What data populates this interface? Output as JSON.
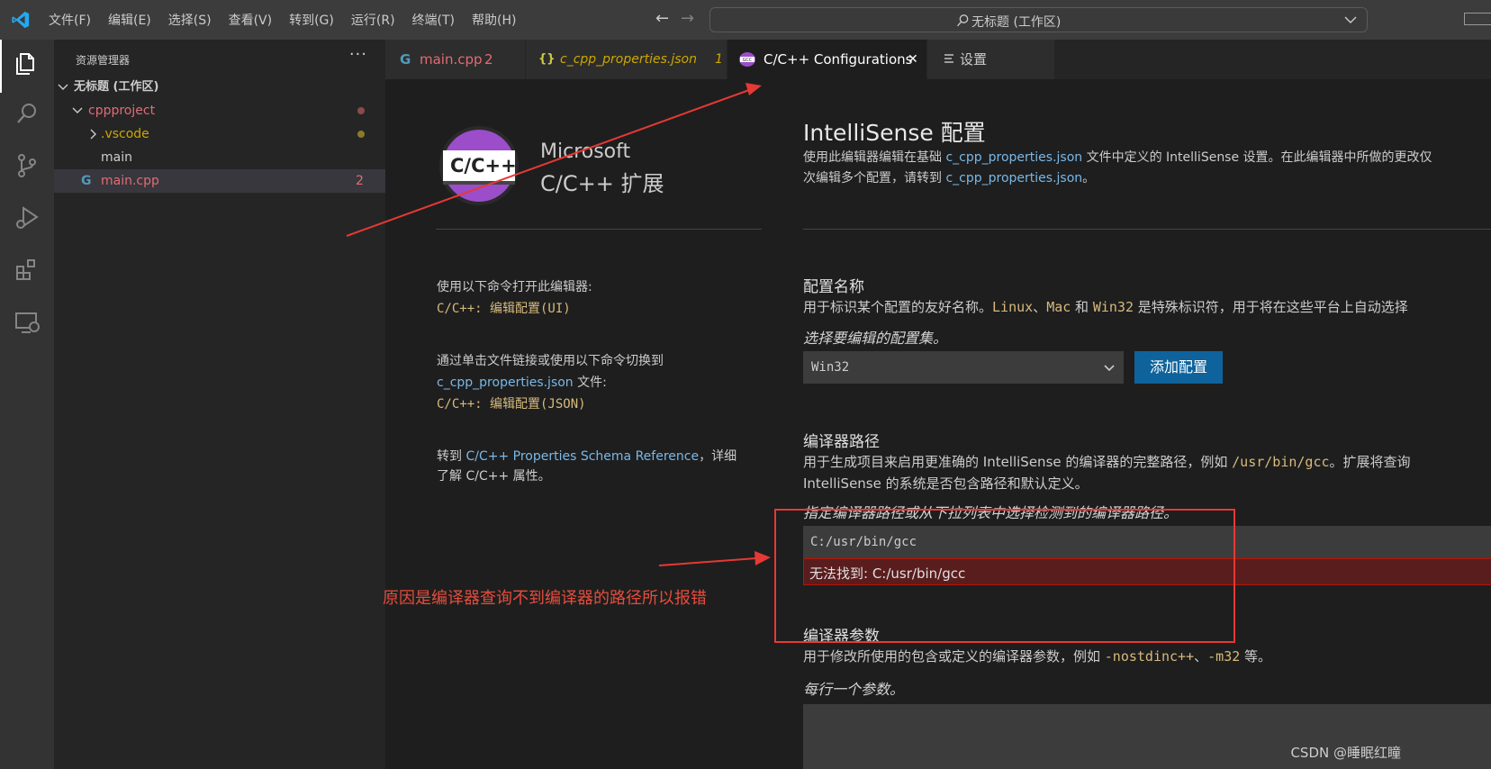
{
  "menu": {
    "items": [
      "文件(F)",
      "编辑(E)",
      "选择(S)",
      "查看(V)",
      "转到(G)",
      "运行(R)",
      "终端(T)",
      "帮助(H)"
    ],
    "command_center": "无标题 (工作区)",
    "back": "←",
    "forward": "→"
  },
  "sidebar": {
    "title": "资源管理器",
    "more": "···",
    "workspace": "无标题 (工作区)",
    "project": "cppproject",
    "vscode_folder": ".vscode",
    "file_main": "main",
    "file_main_cpp": "main.cpp",
    "main_cpp_count": "2"
  },
  "tabs": [
    {
      "label": "main.cpp",
      "badge": "2"
    },
    {
      "label": "c_cpp_properties.json",
      "badge": "1"
    },
    {
      "label": "C/C++ Configurations",
      "close": "✕"
    },
    {
      "label": "设置"
    }
  ],
  "logo": {
    "badge_text": "C/C++",
    "line1": "Microsoft",
    "line2": "C/C++ 扩展"
  },
  "left_help": {
    "open_text": "使用以下命令打开此编辑器:",
    "open_cmd": "C/C++: 编辑配置(UI)",
    "switch_text": "通过单击文件链接或使用以下命令切换到",
    "switch_link": "c_cpp_properties.json",
    "switch_suffix": " 文件:",
    "switch_cmd": "C/C++: 编辑配置(JSON)",
    "goto_prefix": "转到 ",
    "goto_link": "C/C++ Properties Schema Reference",
    "goto_suffix": "，详细",
    "goto_line2": "了解 C/C++ 属性。"
  },
  "header": {
    "title": "IntelliSense 配置",
    "desc_1a": "使用此编辑器编辑在基础 ",
    "desc_link": "c_cpp_properties.json",
    "desc_1b": " 文件中定义的 IntelliSense 设置。在此编辑器中所做的更改仅",
    "desc_2a": "次编辑多个配置，请转到 ",
    "desc_2link": "c_cpp_properties.json",
    "desc_2b": "。"
  },
  "config_name": {
    "title": "配置名称",
    "desc_a": "用于标识某个配置的友好名称。",
    "code1": "Linux",
    "sep1": "、",
    "code2": "Mac",
    "sep2": " 和 ",
    "code3": "Win32",
    "desc_b": " 是特殊标识符，用于将在这些平台上自动选择",
    "hint": "选择要编辑的配置集。",
    "selected": "Win32",
    "add_button": "添加配置"
  },
  "compiler_path": {
    "title": "编译器路径",
    "desc_a": "用于生成项目来启用更准确的 IntelliSense 的编译器的完整路径，例如 ",
    "code": "/usr/bin/gcc",
    "desc_b": "。扩展将查询",
    "desc_line2": "IntelliSense 的系统是否包含路径和默认定义。",
    "hint": "指定编译器路径或从下拉列表中选择检测到的编译器路径。",
    "value": "C:/usr/bin/gcc",
    "error": "无法找到: C:/usr/bin/gcc"
  },
  "compiler_args": {
    "title": "编译器参数",
    "desc_a": "用于修改所使用的包含或定义的编译器参数，例如 ",
    "code1": "-nostdinc++",
    "sep": "、",
    "code2": "-m32",
    "desc_b": " 等。",
    "hint": "每行一个参数。"
  },
  "annotation": {
    "text": "原因是编译器查询不到编译器的路径所以报错"
  },
  "watermark": "CSDN @睡眠红瞳",
  "colors": {
    "accent": "#0e639c",
    "error_bg": "#5a1d1d",
    "annotation_red": "#e53935",
    "link": "#79b8e8",
    "git_modified": "#e06c75"
  }
}
